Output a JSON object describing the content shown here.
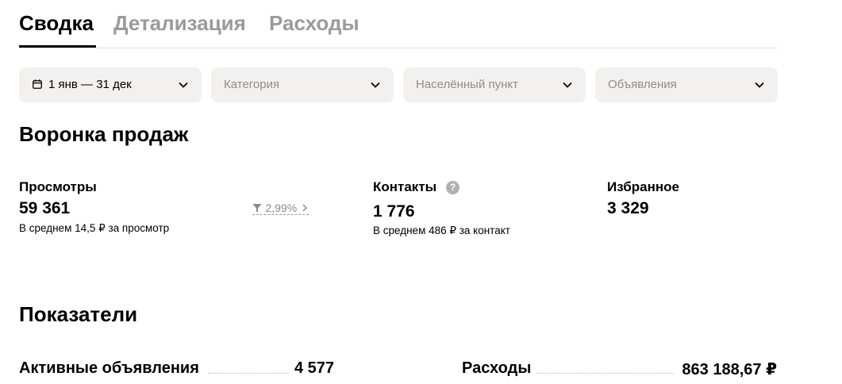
{
  "tabs": [
    {
      "label": "Сводка",
      "active": true
    },
    {
      "label": "Детализация",
      "active": false
    },
    {
      "label": "Расходы",
      "active": false
    }
  ],
  "filters": {
    "date": {
      "value": "1 янв — 31 дек",
      "icon": "calendar-icon"
    },
    "category": {
      "placeholder": "Категория"
    },
    "locality": {
      "placeholder": "Населённый пункт"
    },
    "listings": {
      "placeholder": "Объявления"
    }
  },
  "funnel": {
    "title": "Воронка продаж",
    "views": {
      "label": "Просмотры",
      "value": "59 361",
      "sub": "В среднем 14,5 ₽ за просмотр"
    },
    "conversion": {
      "value": "2,99%"
    },
    "contacts": {
      "label": "Контакты",
      "help": "?",
      "value": "1 776",
      "sub": "В среднем 486 ₽ за контакт"
    },
    "favorites": {
      "label": "Избранное",
      "value": "3 329"
    }
  },
  "indicators": {
    "title": "Показатели",
    "items": [
      {
        "label": "Активные объявления",
        "value": "4 577"
      },
      {
        "label": "Расходы",
        "value": "863 188,67 ₽"
      }
    ]
  },
  "colors": {
    "muted": "#9a9a9a",
    "filter_bg": "#f2f1f0",
    "text": "#000000"
  }
}
